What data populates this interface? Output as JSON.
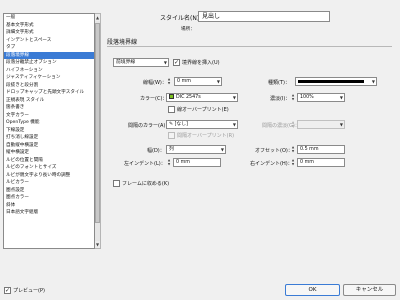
{
  "sidebar": {
    "items": [
      {
        "label": "一般",
        "selected": false
      },
      {
        "label": "基本文字形式",
        "selected": false
      },
      {
        "label": "詳細文字形式",
        "selected": false
      },
      {
        "label": "インデントとスペース",
        "selected": false
      },
      {
        "label": "タブ",
        "selected": false
      },
      {
        "label": "段落境界線",
        "selected": true
      },
      {
        "label": "段落分離禁止オプション",
        "selected": false
      },
      {
        "label": "ハイフネーション",
        "selected": false
      },
      {
        "label": "ジャスティフィケーション",
        "selected": false
      },
      {
        "label": "段抜きと段分割",
        "selected": false
      },
      {
        "label": "ドロップキャップと先頭文字スタイル",
        "selected": false
      },
      {
        "label": "正規表現 スタイル",
        "selected": false
      },
      {
        "label": "箇条書き",
        "selected": false
      },
      {
        "label": "文字カラー",
        "selected": false
      },
      {
        "label": "OpenType 機能",
        "selected": false
      },
      {
        "label": "下線設定",
        "selected": false
      },
      {
        "label": "打ち消し線設定",
        "selected": false
      },
      {
        "label": "自動縦中横設定",
        "selected": false
      },
      {
        "label": "縦中横設定",
        "selected": false
      },
      {
        "label": "ルビの位置と間隔",
        "selected": false
      },
      {
        "label": "ルビのフォントとサイズ",
        "selected": false
      },
      {
        "label": "ルビが親文字より長い時の調整",
        "selected": false
      },
      {
        "label": "ルビカラー",
        "selected": false
      },
      {
        "label": "圏点設定",
        "selected": false
      },
      {
        "label": "圏点カラー",
        "selected": false
      },
      {
        "label": "斜体",
        "selected": false
      },
      {
        "label": "日本語文字組版",
        "selected": false
      }
    ]
  },
  "header": {
    "style_name_label": "スタイル名(N)：",
    "style_name_value": "見出し",
    "location_label": "場所："
  },
  "section": {
    "title": "段落境界線"
  },
  "rule": {
    "position_value": "前境界線",
    "insert_label": "境界線を挿入(U)",
    "insert_checked": true,
    "weight_label": "線幅(W)：",
    "weight_value": "0 mm",
    "type_label": "種類(T)：",
    "color_label": "カラー(C)：",
    "color_value": "DIC 2547s",
    "color_hex": "#7cc21f",
    "tint_label": "濃淡(I)：",
    "tint_value": "100%",
    "overprint_label": "線オーバープリント(E)",
    "gap_color_label": "間隔のカラー(A)：",
    "gap_color_value": "[なし]",
    "gap_tint_label": "間隔の濃淡(G)：",
    "gap_overprint_label": "間隔オーバープリント(R)",
    "width_label": "幅(D)：",
    "width_value": "列",
    "offset_label": "オフセット(O)：",
    "offset_value": "0.5 mm",
    "left_indent_label": "左インデント(L)：",
    "left_indent_value": "0 mm",
    "right_indent_label": "右インデント(H)：",
    "right_indent_value": "0 mm",
    "frame_label": "フレームに収める(K)"
  },
  "footer": {
    "preview_label": "プレビュー(P)",
    "preview_checked": true,
    "ok_label": "OK",
    "cancel_label": "キャンセル"
  },
  "colors": {
    "selection": "#3a7bd5",
    "dialog_bg": "#f0f0f0"
  },
  "icons": {
    "dropdown": "chevron-down-icon",
    "stepper": "up-down-arrows-icon",
    "pencil": "pencil-icon",
    "check": "checkmark-icon"
  }
}
